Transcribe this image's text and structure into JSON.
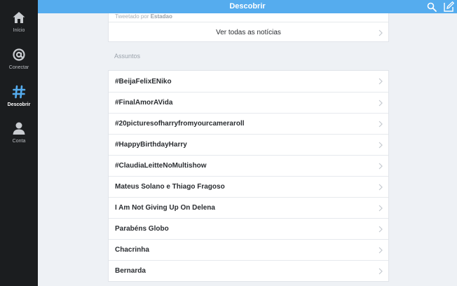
{
  "sidebar": {
    "items": [
      {
        "label": "Início",
        "icon": "home-icon",
        "active": false
      },
      {
        "label": "Conectar",
        "icon": "at-icon",
        "active": false
      },
      {
        "label": "Descobrir",
        "icon": "hashtag-icon",
        "active": true
      },
      {
        "label": "Conta",
        "icon": "person-icon",
        "active": false
      }
    ]
  },
  "header": {
    "title": "Descobrir"
  },
  "news": {
    "tweeted_prefix": "Tweetado por",
    "tweeted_source": "Estadao",
    "see_all_label": "Ver todas as notícias"
  },
  "topics": {
    "section_label": "Assuntos",
    "items": [
      "#BeijaFelixENiko",
      "#FinalAmorAVida",
      "#20picturesofharryfromyourcameraroll",
      "#HappyBirthdayHarry",
      "#ClaudiaLeitteNoMultishow",
      "Mateus Solano e Thiago Fragoso",
      "I Am Not Giving Up On Delena",
      "Parabéns Globo",
      "Chacrinha",
      "Bernarda"
    ]
  },
  "colors": {
    "accent": "#55acee",
    "sidebar_bg": "#1b1d1f",
    "content_bg": "#eef1f5"
  }
}
